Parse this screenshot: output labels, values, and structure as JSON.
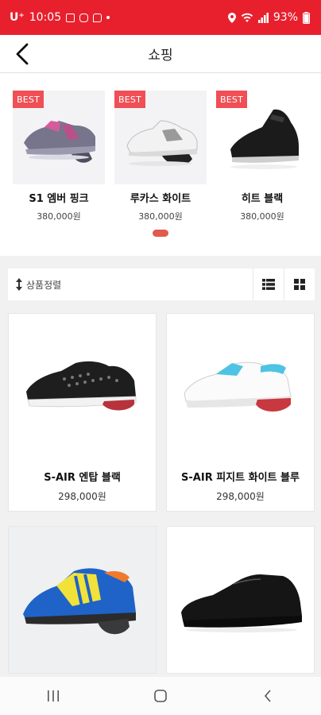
{
  "status": {
    "carrier": "U⁺",
    "time": "10:05",
    "battery": "93%"
  },
  "header": {
    "title": "쇼핑"
  },
  "best": {
    "items": [
      {
        "badge": "BEST",
        "name": "S1 엠버 핑크",
        "price": "380,000원",
        "color": "#7b7aa8"
      },
      {
        "badge": "BEST",
        "name": "루카스 화이트",
        "price": "380,000원",
        "color": "#e8e8e8"
      },
      {
        "badge": "BEST",
        "name": "히트 블랙",
        "price": "380,000원",
        "color": "#1a1a1a"
      }
    ]
  },
  "sort": {
    "label": "상품정렬"
  },
  "products": [
    {
      "name": "S-AIR 엔탑 블랙",
      "price": "298,000원"
    },
    {
      "name": "S-AIR 피지트 화이트 블루",
      "price": "298,000원"
    },
    {
      "name": "",
      "price": ""
    },
    {
      "name": "",
      "price": ""
    }
  ],
  "colors": {
    "statusbar": "#e8202e",
    "badge": "#ef4f55",
    "indicator": "#e05a4e"
  }
}
